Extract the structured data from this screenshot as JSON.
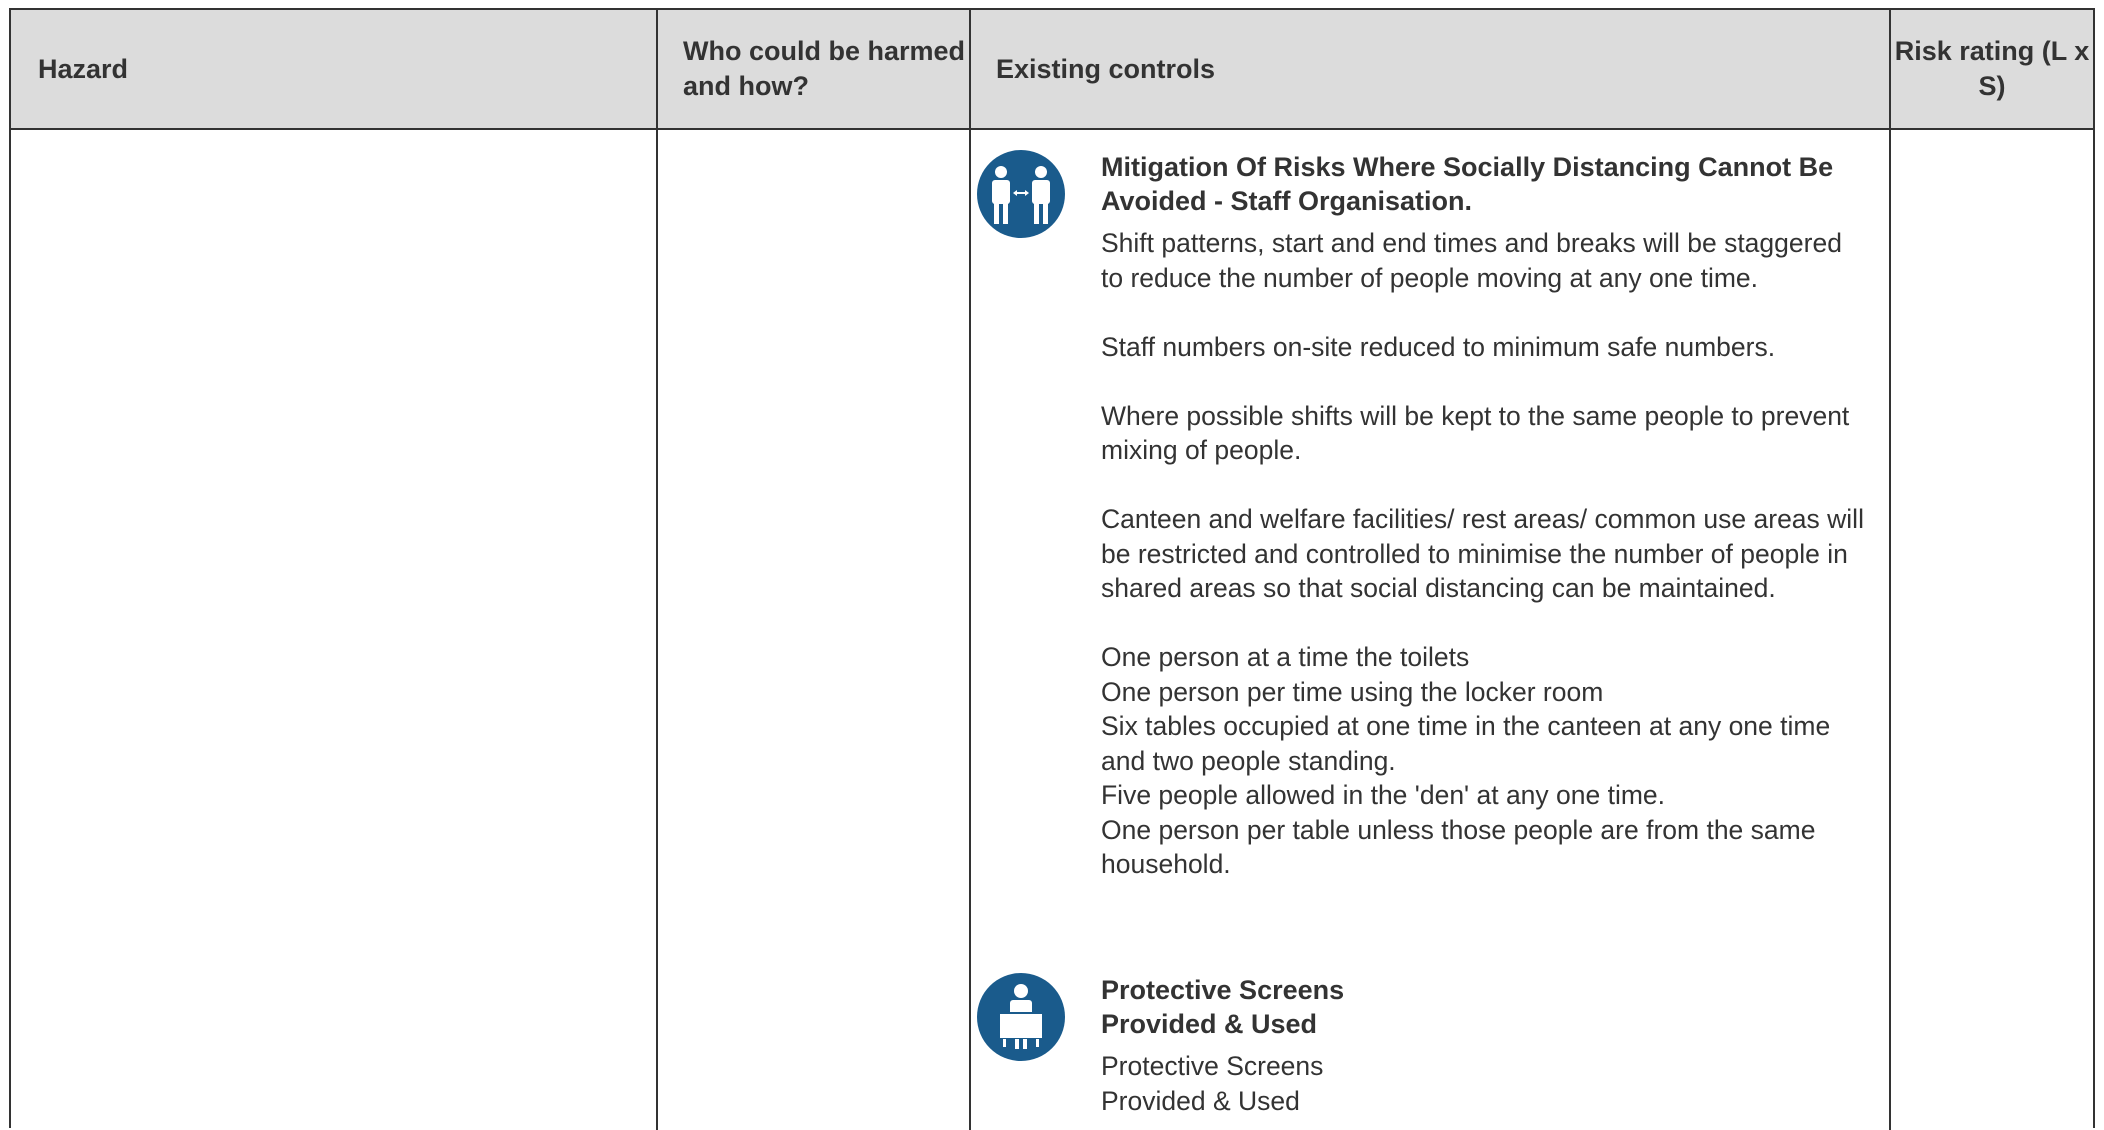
{
  "table": {
    "headers": {
      "hazard": "Hazard",
      "who": "Who could be harmed and how?",
      "controls": "Existing controls",
      "risk": "Risk rating (L x S)"
    }
  },
  "controls": [
    {
      "icon": "social-distancing-icon",
      "title": "Mitigation Of Risks Where Socially Distancing Cannot Be Avoided - Staff Organisation.",
      "paragraphs": [
        "Shift patterns, start and end times and breaks will be staggered to reduce the number of people moving at any one time.",
        "Staff numbers on-site reduced to minimum safe numbers.",
        "Where possible shifts will be kept to the same people to prevent mixing of people.",
        "Canteen and welfare facilities/ rest areas/ common use areas will be restricted and controlled to minimise the number of people in shared areas so that social distancing can be maintained."
      ],
      "lines": [
        "One person at a time the toilets",
        "One person per time using the locker room",
        "Six tables occupied at one time in the canteen at any one time and two people standing.",
        "Five people allowed in the 'den' at any one time.",
        "One person per table unless those people are from the same household."
      ]
    },
    {
      "icon": "protective-screen-icon",
      "title_line1": "Protective Screens",
      "title_line2": "Provided & Used",
      "body_line1": "Protective Screens",
      "body_line2": "Provided & Used"
    }
  ]
}
